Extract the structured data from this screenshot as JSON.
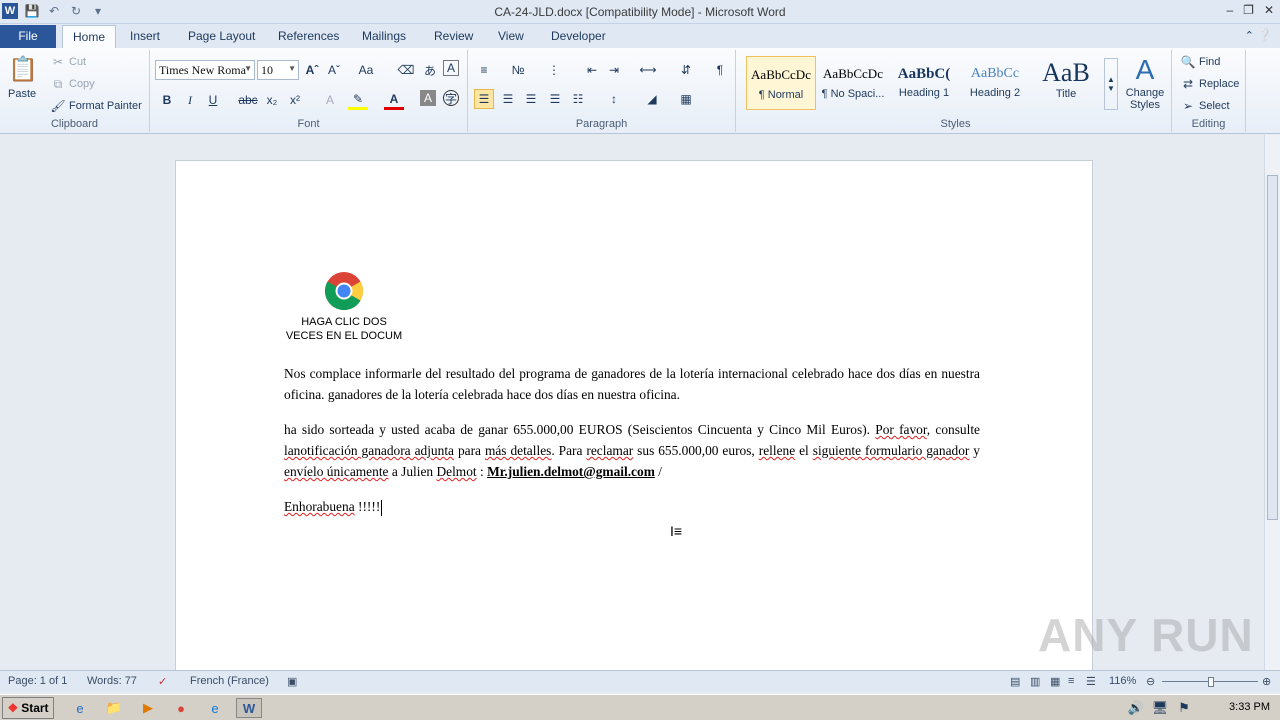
{
  "window": {
    "title": "CA-24-JLD.docx [Compatibility Mode]  -  Microsoft Word",
    "app_icon": "W"
  },
  "tabs": [
    "File",
    "Home",
    "Insert",
    "Page Layout",
    "References",
    "Mailings",
    "Review",
    "View",
    "Developer"
  ],
  "active_tab": "Home",
  "ribbon": {
    "clipboard": {
      "label": "Clipboard",
      "paste": "Paste",
      "cut": "Cut",
      "copy": "Copy",
      "format_painter": "Format Painter"
    },
    "font": {
      "label": "Font",
      "font_name": "Times New Roma",
      "font_size": "10"
    },
    "paragraph": {
      "label": "Paragraph"
    },
    "styles": {
      "label": "Styles",
      "items": [
        {
          "sample": "AaBbCcDc",
          "name": "¶ Normal"
        },
        {
          "sample": "AaBbCcDc",
          "name": "¶ No Spaci..."
        },
        {
          "sample": "AaBbC(",
          "name": "Heading 1"
        },
        {
          "sample": "AaBbCc",
          "name": "Heading 2"
        },
        {
          "sample": "AaB",
          "name": "Title"
        }
      ],
      "change_styles": "Change Styles"
    },
    "editing": {
      "label": "Editing",
      "find": "Find",
      "replace": "Replace",
      "select": "Select"
    }
  },
  "document": {
    "image_caption_line1": "HAGA CLIC DOS",
    "image_caption_line2": "VECES EN EL DOCUM",
    "para1": "Nos complace informarle del resultado del programa de ganadores de la lotería internacional celebrado hace dos días en nuestra oficina. ganadores de la lotería celebrada hace dos días en nuestra oficina.",
    "para2_a": "ha sido sorteada y usted acaba de ganar 655.000,00 EUROS (Seiscientos Cincuenta y Cinco Mil Euros). ",
    "para2_b": "Por favor",
    "para2_c": ", consulte ",
    "para2_d": "lanotificación ganadora adjunta",
    "para2_e": " para ",
    "para2_f": "más detalles",
    "para2_g": ". Para ",
    "para2_h": "reclamar",
    "para2_i": " sus 655.000,00 euros, ",
    "para2_j": "rellene",
    "para2_k": " el ",
    "para2_l": "siguiente formulario ganador",
    "para2_m": " y ",
    "para2_n": "envíelo únicamente",
    "para2_o": " a Julien ",
    "para2_p": "Delmot",
    "para2_q": " : ",
    "email": "Mr.julien.delmot@gmail.com",
    "para2_r": " /",
    "para3_a": "Enhorabuena",
    "para3_b": " !!!!!"
  },
  "status": {
    "page": "Page: 1 of 1",
    "words": "Words: 77",
    "language": "French (France)",
    "zoom": "116%"
  },
  "taskbar": {
    "start": "Start",
    "clock": "3:33 PM"
  },
  "watermark": "ANY RUN"
}
